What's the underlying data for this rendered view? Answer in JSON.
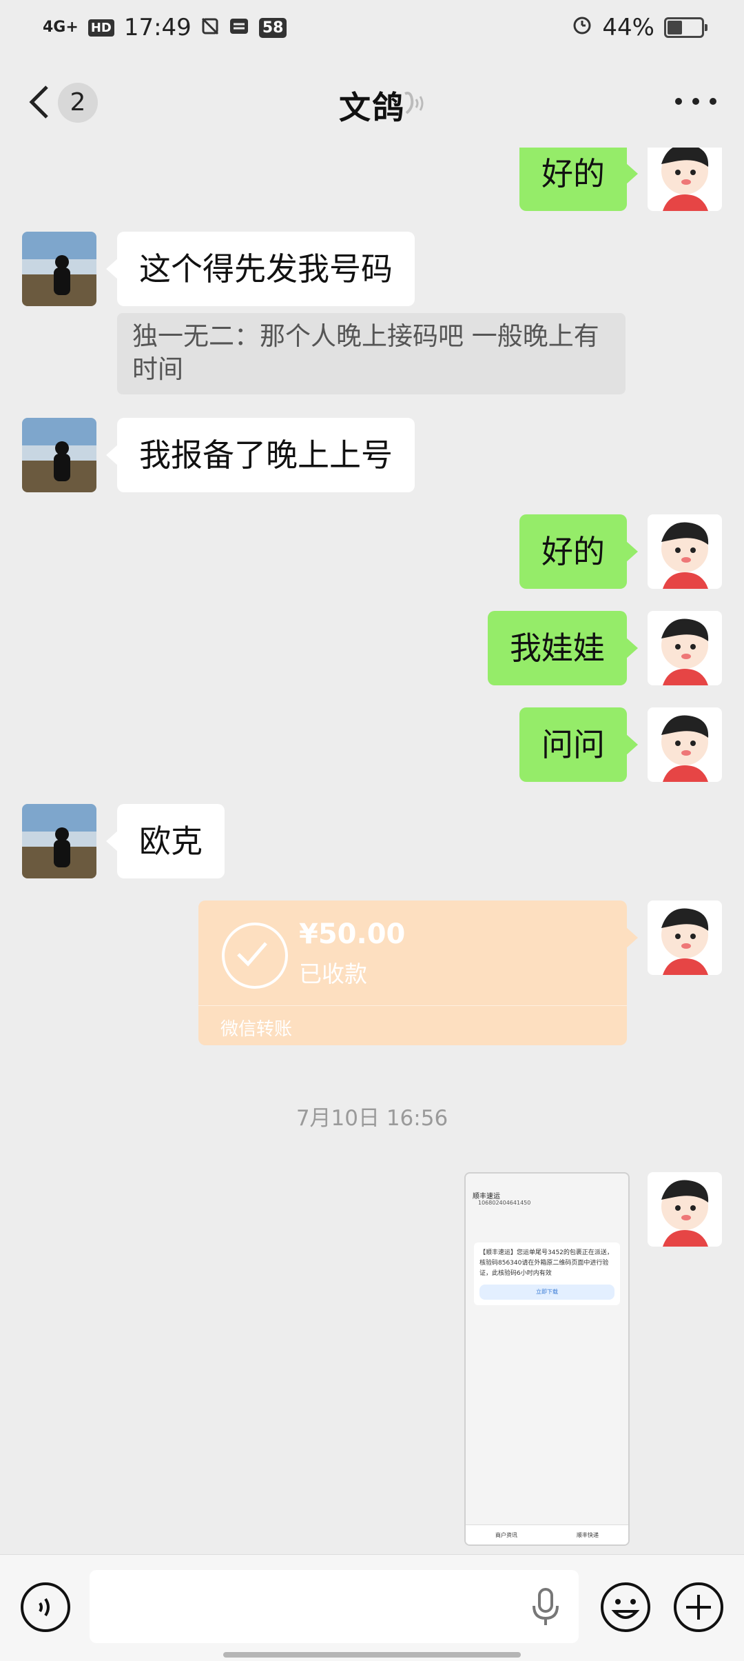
{
  "status_bar": {
    "network": "4G+",
    "hd": "HD",
    "time": "17:49",
    "notification_count": "58",
    "battery": "44%",
    "battery_level": 0.44
  },
  "header": {
    "back_unread": "2",
    "title": "文鸽"
  },
  "messages": {
    "m1": "好的",
    "m2": "这个得先发我号码",
    "m2_quote": "独一无二：那个人晚上接码吧 一般晚上有时间",
    "m3": "我报备了晚上上号",
    "m4": "好的",
    "m5": "我娃娃",
    "m6": "问问",
    "m7": "欧克"
  },
  "transfer": {
    "amount": "¥50.00",
    "status": "已收款",
    "label": "微信转账"
  },
  "timestamp": "7月10日 16:56",
  "screenshot_image": {
    "sender": "顺丰速运",
    "number": "106802404641450",
    "body": "【顺丰速运】您运单尾号3452的包裹正在派送，核验码856340请在外箱原二维码页面中进行验证，此核验码6小时内有效",
    "button": "立即下载",
    "tabs": [
      "商户资讯",
      "顺丰快递"
    ]
  },
  "colors": {
    "background": "#ededed",
    "my_bubble": "#95ec69",
    "other_bubble": "#ffffff",
    "transfer_card": "#fddfc0"
  }
}
